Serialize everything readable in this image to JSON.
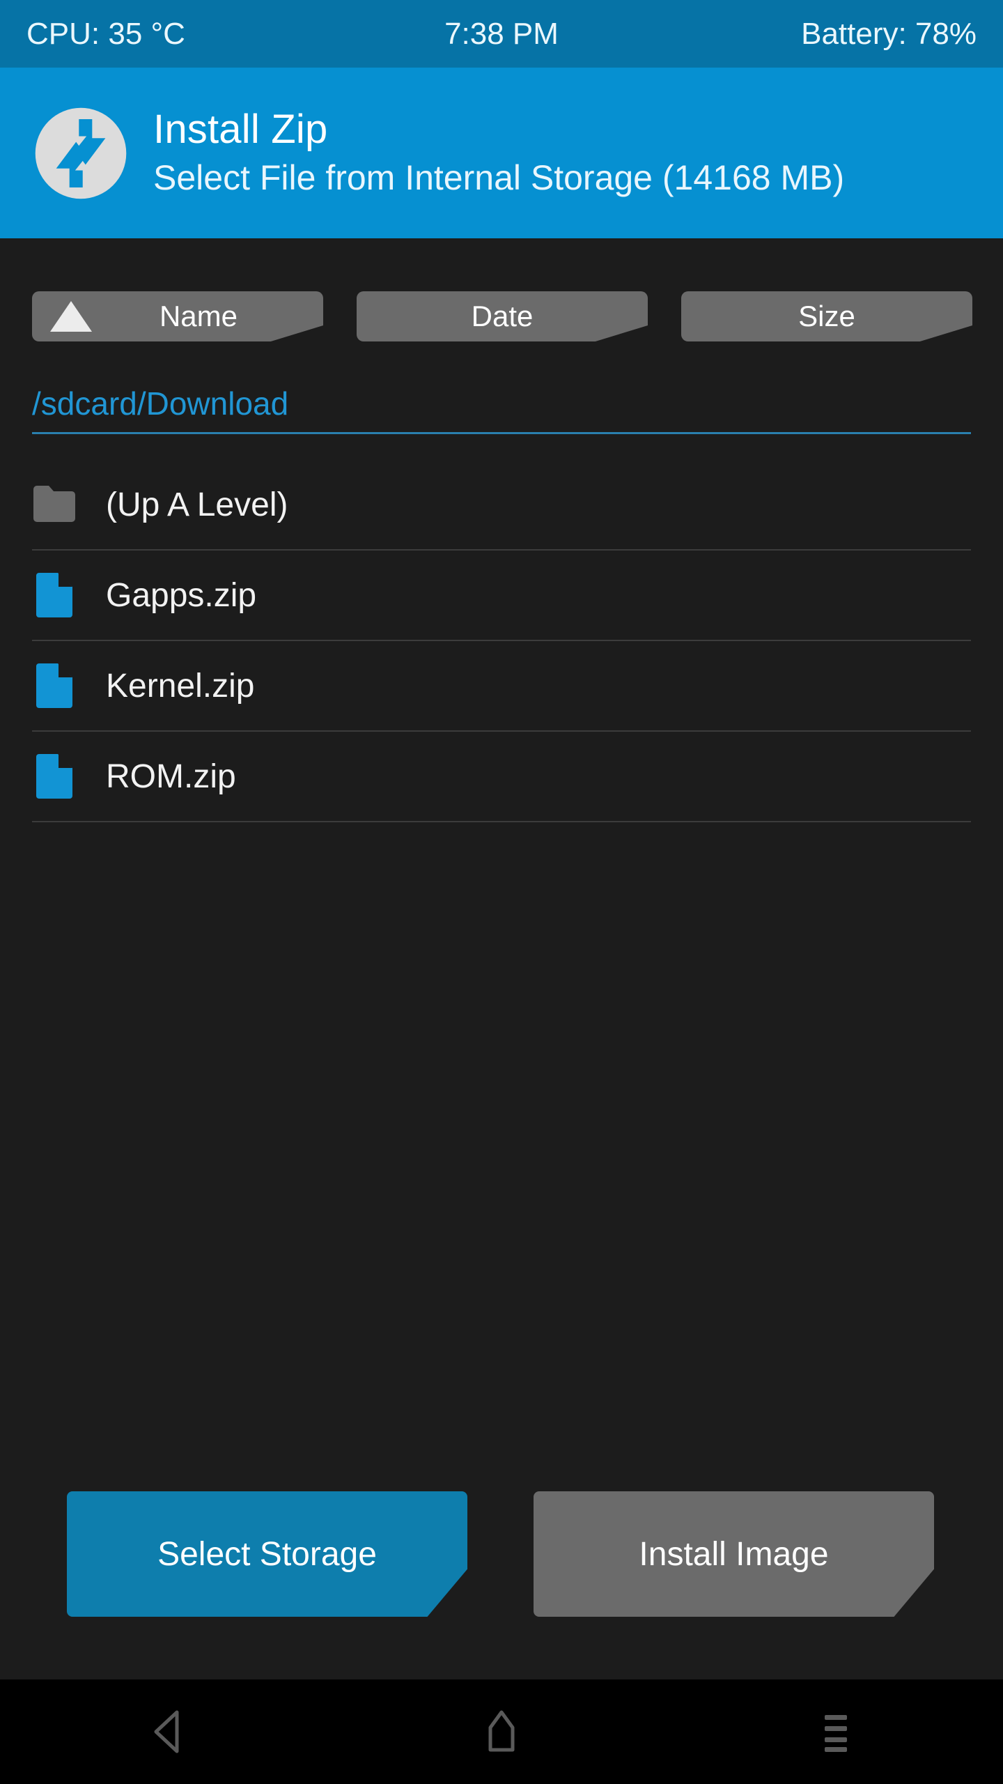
{
  "status_bar": {
    "cpu": "CPU: 35 °C",
    "time": "7:38 PM",
    "battery": "Battery: 78%"
  },
  "header": {
    "logo_icon": "twrp-logo-icon",
    "title": "Install Zip",
    "subtitle": "Select File from Internal Storage (14168 MB)"
  },
  "sort_bar": {
    "ascending_icon": "sort-ascending-triangle-icon",
    "buttons": [
      {
        "label": "Name",
        "active": true
      },
      {
        "label": "Date",
        "active": false
      },
      {
        "label": "Size",
        "active": false
      }
    ]
  },
  "path_bar": {
    "path": "/sdcard/Download"
  },
  "file_list": {
    "rows": [
      {
        "label": "(Up A Level)",
        "icon": "folder-icon",
        "type": "folder"
      },
      {
        "label": "Gapps.zip",
        "icon": "file-zip-icon",
        "type": "file"
      },
      {
        "label": "Kernel.zip",
        "icon": "file-zip-icon",
        "type": "file"
      },
      {
        "label": "ROM.zip",
        "icon": "file-zip-icon",
        "type": "file"
      }
    ]
  },
  "actions": {
    "select_storage_label": "Select Storage",
    "install_image_label": "Install Image"
  },
  "nav_bar": {
    "back_icon": "back-triangle-icon",
    "home_icon": "home-icon",
    "menu_icon": "menu-lines-icon"
  },
  "colors": {
    "status_bar_bg": "#0673a6",
    "header_bg": "#0690d1",
    "app_bg": "#1c1c1c",
    "accent_blue": "#0e7ead",
    "path_blue": "#2196d4",
    "file_icon_blue": "#1294d4",
    "button_gray": "#6b6b6b",
    "folder_gray": "#6b6b6b",
    "divider": "#3c3c3c",
    "nav_bar_bg": "#000000",
    "nav_icon": "#5a5a5a"
  }
}
